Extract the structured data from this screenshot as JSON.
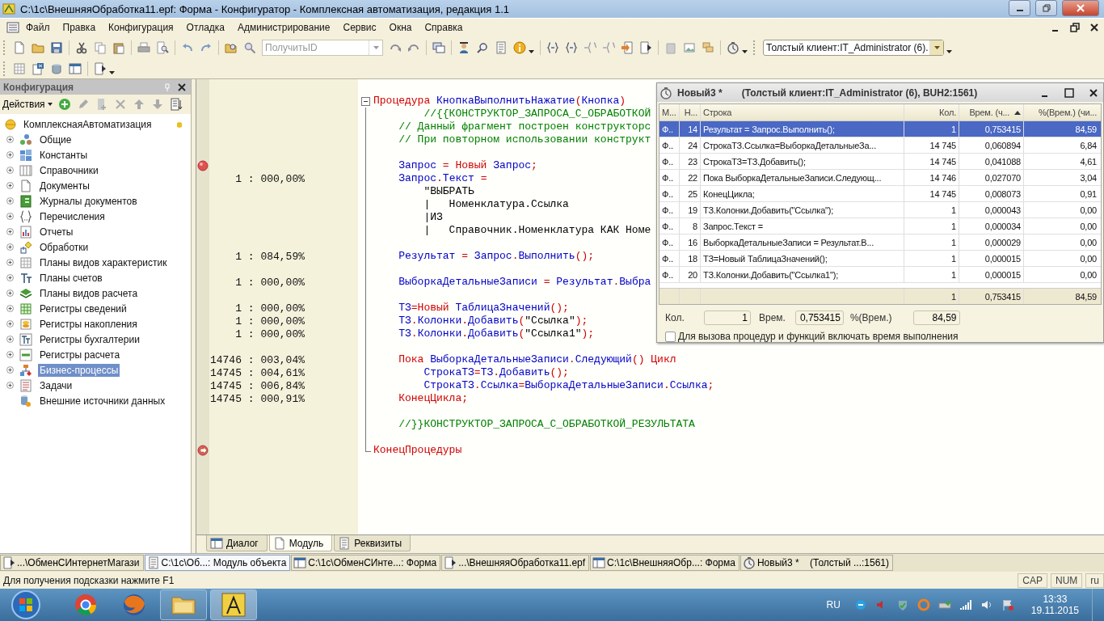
{
  "window": {
    "title": "C:\\1c\\ВнешняяОбработка11.epf: Форма - Конфигуратор - Комплексная автоматизация, редакция 1.1"
  },
  "menu": [
    "Файл",
    "Правка",
    "Конфигурация",
    "Отладка",
    "Администрирование",
    "Сервис",
    "Окна",
    "Справка"
  ],
  "toolbar": {
    "search_combo": {
      "placeholder": "ПолучитьID"
    },
    "client_combo": {
      "value": "Толстый клиент:IT_Administrator (6)."
    }
  },
  "config_panel": {
    "title": "Конфигурация",
    "actions": "Действия",
    "root": {
      "label": "КомплекснаяАвтоматизация",
      "children": [
        {
          "label": "Общие",
          "expandable": true,
          "selected": false
        },
        {
          "label": "Константы",
          "expandable": true,
          "selected": false
        },
        {
          "label": "Справочники",
          "expandable": true,
          "selected": false
        },
        {
          "label": "Документы",
          "expandable": true,
          "selected": false
        },
        {
          "label": "Журналы документов",
          "expandable": true,
          "selected": false
        },
        {
          "label": "Перечисления",
          "expandable": true,
          "selected": false
        },
        {
          "label": "Отчеты",
          "expandable": true,
          "selected": false
        },
        {
          "label": "Обработки",
          "expandable": true,
          "selected": false
        },
        {
          "label": "Планы видов характеристик",
          "expandable": true,
          "selected": false
        },
        {
          "label": "Планы счетов",
          "expandable": true,
          "selected": false
        },
        {
          "label": "Планы видов расчета",
          "expandable": true,
          "selected": false
        },
        {
          "label": "Регистры сведений",
          "expandable": true,
          "selected": false
        },
        {
          "label": "Регистры накопления",
          "expandable": true,
          "selected": false
        },
        {
          "label": "Регистры бухгалтерии",
          "expandable": true,
          "selected": false
        },
        {
          "label": "Регистры расчета",
          "expandable": true,
          "selected": false
        },
        {
          "label": "Бизнес-процессы",
          "expandable": true,
          "selected": true
        },
        {
          "label": "Задачи",
          "expandable": true,
          "selected": false
        },
        {
          "label": "Внешние источники данных",
          "expandable": false,
          "selected": false
        }
      ]
    }
  },
  "editor": {
    "lines": [
      {
        "tokens": [
          {
            "kind": "kw",
            "text": "Процедура "
          },
          {
            "kind": "id",
            "text": "КнопкаВыполнитьНажатие"
          },
          {
            "kind": "kw",
            "text": "("
          },
          {
            "kind": "id",
            "text": "Кнопка"
          },
          {
            "kind": "kw",
            "text": ")"
          }
        ]
      },
      {
        "tokens": [
          {
            "kind": "cm",
            "text": "        //{{КОНСТРУКТОР_ЗАПРОСА_С_ОБРАБОТКОЙ"
          }
        ]
      },
      {
        "tokens": [
          {
            "kind": "cm",
            "text": "    // Данный фрагмент построен конструкторс"
          }
        ]
      },
      {
        "tokens": [
          {
            "kind": "cm",
            "text": "    // При повторном использовании конструкт"
          }
        ]
      },
      {
        "blank": true
      },
      {
        "breakpoint": true,
        "tokens": [
          {
            "kind": "id",
            "text": "    Запрос"
          },
          {
            "kind": "kw",
            "text": " = Новый "
          },
          {
            "kind": "id",
            "text": "Запрос"
          },
          {
            "kind": "kw",
            "text": ";"
          }
        ]
      },
      {
        "count": "1 : 000,00%",
        "tokens": [
          {
            "kind": "id",
            "text": "    Запрос"
          },
          {
            "kind": "kw",
            "text": "."
          },
          {
            "kind": "id",
            "text": "Текст"
          },
          {
            "kind": "kw",
            "text": " ="
          }
        ]
      },
      {
        "tokens": [
          {
            "kind": "st",
            "text": "        \"ВЫБРАТЬ"
          }
        ]
      },
      {
        "tokens": [
          {
            "kind": "st",
            "text": "        |   Номенклатура.Ссылка"
          }
        ]
      },
      {
        "tokens": [
          {
            "kind": "st",
            "text": "        |ИЗ"
          }
        ]
      },
      {
        "tokens": [
          {
            "kind": "st",
            "text": "        |   Справочник.Номенклатура КАК Номе"
          }
        ]
      },
      {
        "blank": true
      },
      {
        "count": "1 : 084,59%",
        "tokens": [
          {
            "kind": "id",
            "text": "    Результат"
          },
          {
            "kind": "kw",
            "text": " = "
          },
          {
            "kind": "id",
            "text": "Запрос"
          },
          {
            "kind": "kw",
            "text": "."
          },
          {
            "kind": "id",
            "text": "Выполнить"
          },
          {
            "kind": "kw",
            "text": "();"
          }
        ]
      },
      {
        "blank": true
      },
      {
        "count": "1 : 000,00%",
        "tokens": [
          {
            "kind": "id",
            "text": "    ВыборкаДетальныеЗаписи"
          },
          {
            "kind": "kw",
            "text": " = "
          },
          {
            "kind": "id",
            "text": "Результат"
          },
          {
            "kind": "kw",
            "text": "."
          },
          {
            "kind": "id",
            "text": "Выбра"
          }
        ]
      },
      {
        "blank": true
      },
      {
        "count": "1 : 000,00%",
        "tokens": [
          {
            "kind": "id",
            "text": "    ТЗ"
          },
          {
            "kind": "kw",
            "text": "=Новый "
          },
          {
            "kind": "id",
            "text": "ТаблицаЗначений"
          },
          {
            "kind": "kw",
            "text": "();"
          }
        ]
      },
      {
        "count": "1 : 000,00%",
        "tokens": [
          {
            "kind": "id",
            "text": "    ТЗ"
          },
          {
            "kind": "kw",
            "text": "."
          },
          {
            "kind": "id",
            "text": "Колонки"
          },
          {
            "kind": "kw",
            "text": "."
          },
          {
            "kind": "id",
            "text": "Добавить"
          },
          {
            "kind": "kw",
            "text": "("
          },
          {
            "kind": "st",
            "text": "\"Ссылка\""
          },
          {
            "kind": "kw",
            "text": ");"
          }
        ]
      },
      {
        "count": "1 : 000,00%",
        "tokens": [
          {
            "kind": "id",
            "text": "    ТЗ"
          },
          {
            "kind": "kw",
            "text": "."
          },
          {
            "kind": "id",
            "text": "Колонки"
          },
          {
            "kind": "kw",
            "text": "."
          },
          {
            "kind": "id",
            "text": "Добавить"
          },
          {
            "kind": "kw",
            "text": "("
          },
          {
            "kind": "st",
            "text": "\"Ссылка1\""
          },
          {
            "kind": "kw",
            "text": ");"
          }
        ]
      },
      {
        "blank": true
      },
      {
        "count": "14746 : 003,04%",
        "tokens": [
          {
            "kind": "kw",
            "text": "    Пока "
          },
          {
            "kind": "id",
            "text": "ВыборкаДетальныеЗаписи"
          },
          {
            "kind": "kw",
            "text": "."
          },
          {
            "kind": "id",
            "text": "Следующий"
          },
          {
            "kind": "kw",
            "text": "() Цикл"
          }
        ]
      },
      {
        "count": "14745 : 004,61%",
        "tokens": [
          {
            "kind": "id",
            "text": "        СтрокаТЗ"
          },
          {
            "kind": "kw",
            "text": "="
          },
          {
            "kind": "id",
            "text": "ТЗ"
          },
          {
            "kind": "kw",
            "text": "."
          },
          {
            "kind": "id",
            "text": "Добавить"
          },
          {
            "kind": "kw",
            "text": "();"
          }
        ]
      },
      {
        "count": "14745 : 006,84%",
        "tokens": [
          {
            "kind": "id",
            "text": "        СтрокаТЗ"
          },
          {
            "kind": "kw",
            "text": "."
          },
          {
            "kind": "id",
            "text": "Ссылка"
          },
          {
            "kind": "kw",
            "text": "="
          },
          {
            "kind": "id",
            "text": "ВыборкаДетальныеЗаписи"
          },
          {
            "kind": "kw",
            "text": "."
          },
          {
            "kind": "id",
            "text": "Ссылка"
          },
          {
            "kind": "kw",
            "text": ";"
          }
        ]
      },
      {
        "count": "14745 : 000,91%",
        "tokens": [
          {
            "kind": "kw",
            "text": "    КонецЦикла;"
          }
        ]
      },
      {
        "blank": true
      },
      {
        "tokens": [
          {
            "kind": "cm",
            "text": "    //}}КОНСТРУКТОР_ЗАПРОСА_С_ОБРАБОТКОЙ_РЕЗУЛЬТАТА"
          }
        ]
      },
      {
        "blank": true
      },
      {
        "current_line": true,
        "tokens": [
          {
            "kind": "kw",
            "text": "КонецПроцедуры"
          }
        ]
      }
    ],
    "tabs": [
      {
        "label": "Диалог",
        "selected": false
      },
      {
        "label": "Модуль",
        "selected": true
      },
      {
        "label": "Реквизиты",
        "selected": false
      }
    ]
  },
  "profiler": {
    "title": "Новый3 *",
    "subtitle": "(Толстый клиент:IT_Administrator (6), BUH2:1561)",
    "columns": [
      {
        "label": "М...",
        "sorted": false
      },
      {
        "label": "Н...",
        "sorted": false
      },
      {
        "label": "Строка",
        "sorted": false
      },
      {
        "label": "Кол.",
        "sorted": false
      },
      {
        "label": "Врем. (ч...",
        "sorted": true
      },
      {
        "label": "%(Врем.) (чи...",
        "sorted": false
      }
    ],
    "rows": [
      {
        "module": "Ф..",
        "line": "14",
        "text": "Результат = Запрос.Выполнить();",
        "count": "1",
        "time": "0,753415",
        "percent": "84,59",
        "selected": true
      },
      {
        "module": "Ф..",
        "line": "24",
        "text": "СтрокаТЗ.Ссылка=ВыборкаДетальныеЗа...",
        "count": "14 745",
        "time": "0,060894",
        "percent": "6,84",
        "selected": false
      },
      {
        "module": "Ф..",
        "line": "23",
        "text": "СтрокаТЗ=ТЗ.Добавить();",
        "count": "14 745",
        "time": "0,041088",
        "percent": "4,61",
        "selected": false
      },
      {
        "module": "Ф..",
        "line": "22",
        "text": "Пока ВыборкаДетальныеЗаписи.Следующ...",
        "count": "14 746",
        "time": "0,027070",
        "percent": "3,04",
        "selected": false
      },
      {
        "module": "Ф..",
        "line": "25",
        "text": "КонецЦикла;",
        "count": "14 745",
        "time": "0,008073",
        "percent": "0,91",
        "selected": false
      },
      {
        "module": "Ф..",
        "line": "19",
        "text": "ТЗ.Колонки.Добавить(\"Ссылка\");",
        "count": "1",
        "time": "0,000043",
        "percent": "0,00",
        "selected": false
      },
      {
        "module": "Ф..",
        "line": "8",
        "text": "Запрос.Текст =",
        "count": "1",
        "time": "0,000034",
        "percent": "0,00",
        "selected": false
      },
      {
        "module": "Ф..",
        "line": "16",
        "text": "ВыборкаДетальныеЗаписи = Результат.В...",
        "count": "1",
        "time": "0,000029",
        "percent": "0,00",
        "selected": false
      },
      {
        "module": "Ф..",
        "line": "18",
        "text": "ТЗ=Новый ТаблицаЗначений();",
        "count": "1",
        "time": "0,000015",
        "percent": "0,00",
        "selected": false
      },
      {
        "module": "Ф..",
        "line": "20",
        "text": "ТЗ.Колонки.Добавить(\"Ссылка1\");",
        "count": "1",
        "time": "0,000015",
        "percent": "0,00",
        "selected": false
      }
    ],
    "total": {
      "count": "1",
      "time": "0,753415",
      "percent": "84,59"
    },
    "fields": [
      {
        "label": "Кол.",
        "value": "1"
      },
      {
        "label": "Врем.",
        "value": "0,753415"
      },
      {
        "label": "%(Врем.)",
        "value": "84,59"
      }
    ],
    "include_calls": {
      "label": "Для вызова процедур и функций включать время выполнения",
      "checked": false
    }
  },
  "window_tabs": [
    {
      "label": "...\\ОбменСИнтернетМагази",
      "selected": false
    },
    {
      "label": "C:\\1c\\Об...: Модуль объекта",
      "selected": true
    },
    {
      "label": "C:\\1c\\ОбменСИнте...: Форма",
      "selected": false
    },
    {
      "label": "...\\ВнешняяОбработка11.epf",
      "selected": false
    },
    {
      "label": "C:\\1c\\ВнешняяОбр...: Форма",
      "selected": false
    },
    {
      "label": "Новый3 *",
      "detail": "(Толстый ...:1561)",
      "selected": false
    }
  ],
  "status_bar": {
    "hint": "Для получения подсказки нажмите F1",
    "indicators": [
      "CAP",
      "NUM",
      "ru"
    ]
  },
  "taskbar": {
    "language": "RU",
    "time": "13:33",
    "date": "19.11.2015"
  }
}
